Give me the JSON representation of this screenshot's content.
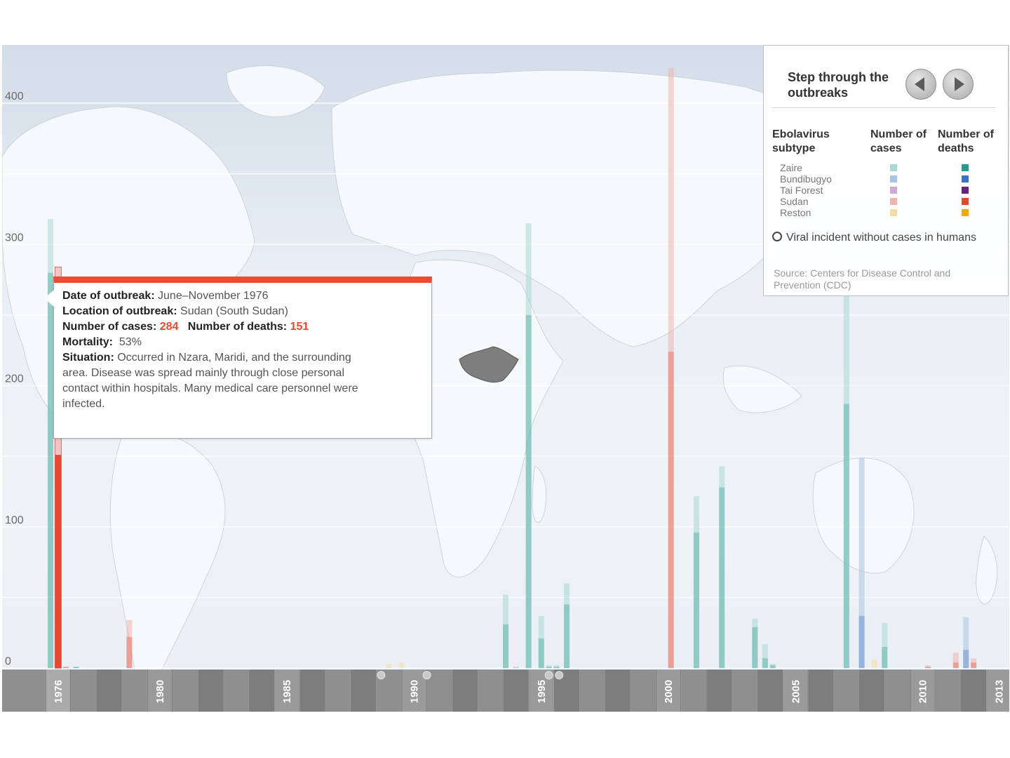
{
  "legend": {
    "step_title": "Step through the outbreaks",
    "col_subtype": "Ebolavirus subtype",
    "col_cases": "Number of cases",
    "col_deaths": "Number of deaths",
    "subtypes": [
      {
        "name": "Zaire",
        "case_color": "#a9d9d4",
        "death_color": "#2a9a8c"
      },
      {
        "name": "Bundibugyo",
        "case_color": "#a9c4e2",
        "death_color": "#3b72c2"
      },
      {
        "name": "Tai Forest",
        "case_color": "#cfa9d3",
        "death_color": "#6a2383"
      },
      {
        "name": "Sudan",
        "case_color": "#f1b3ad",
        "death_color": "#e8482f"
      },
      {
        "name": "Reston",
        "case_color": "#f6dd9f",
        "death_color": "#f1a712"
      }
    ],
    "circle_note": "Viral incident without cases in humans",
    "source": "Source: Centers for Disease Control and Prevention (CDC)"
  },
  "tooltip": {
    "date_label": "Date of outbreak:",
    "date_value": "June–November 1976",
    "location_label": "Location of outbreak:",
    "location_value": "Sudan (South Sudan)",
    "cases_label": "Number of cases:",
    "cases_value": "284",
    "deaths_label": "Number of deaths:",
    "deaths_value": "151",
    "mortality_label": "Mortality:",
    "mortality_value": "53%",
    "situation_label": "Situation:",
    "situation_value": "Occurred in Nzara, Maridi, and the surrounding area. Disease was spread mainly through close personal contact within hospitals. Many medical care personnel were infected."
  },
  "map": {
    "highlighted_region": "South Sudan",
    "highlight_color": "#7f7f7f"
  },
  "chart_data": {
    "type": "bar",
    "title": "",
    "xlabel": "",
    "ylabel": "",
    "ylim": [
      0,
      480
    ],
    "yticks": [
      0,
      100,
      200,
      300,
      400
    ],
    "x_range": [
      1975.4,
      2013.6
    ],
    "year_labels": [
      "1976",
      "1980",
      "1985",
      "1990",
      "1995",
      "2000",
      "2005",
      "2010",
      "2013"
    ],
    "colors": {
      "Zaire": [
        "#a9d9d4",
        "#2a9a8c"
      ],
      "Bundibugyo": [
        "#a9c4e2",
        "#3b72c2"
      ],
      "Tai Forest": [
        "#cfa9d3",
        "#6a2383"
      ],
      "Sudan": [
        "#f1b3ad",
        "#e8482f"
      ],
      "Reston": [
        "#f6dd9f",
        "#f1a712"
      ]
    },
    "outbreaks": [
      {
        "year": 1976.2,
        "subtype": "Zaire",
        "cases": 318,
        "deaths": 280
      },
      {
        "year": 1976.5,
        "subtype": "Sudan",
        "cases": 284,
        "deaths": 151,
        "selected": true
      },
      {
        "year": 1976.8,
        "subtype": "Sudan",
        "cases": 1,
        "deaths": 1
      },
      {
        "year": 1977.2,
        "subtype": "Zaire",
        "cases": 1,
        "deaths": 1
      },
      {
        "year": 1979.3,
        "subtype": "Sudan",
        "cases": 34,
        "deaths": 22
      },
      {
        "year": 1989.5,
        "subtype": "Reston",
        "cases": 3,
        "deaths": 0
      },
      {
        "year": 1990.0,
        "subtype": "Reston",
        "cases": 4,
        "deaths": 0
      },
      {
        "year": 1994.1,
        "subtype": "Zaire",
        "cases": 52,
        "deaths": 31
      },
      {
        "year": 1994.5,
        "subtype": "Tai Forest",
        "cases": 1,
        "deaths": 0
      },
      {
        "year": 1995.0,
        "subtype": "Zaire",
        "cases": 315,
        "deaths": 250
      },
      {
        "year": 1995.5,
        "subtype": "Zaire",
        "cases": 37,
        "deaths": 21
      },
      {
        "year": 1995.8,
        "subtype": "Zaire",
        "cases": 2,
        "deaths": 1
      },
      {
        "year": 1996.1,
        "subtype": "Zaire",
        "cases": 2,
        "deaths": 1
      },
      {
        "year": 1996.5,
        "subtype": "Zaire",
        "cases": 60,
        "deaths": 45
      },
      {
        "year": 2000.6,
        "subtype": "Sudan",
        "cases": 425,
        "deaths": 224
      },
      {
        "year": 2001.6,
        "subtype": "Zaire",
        "cases": 122,
        "deaths": 96
      },
      {
        "year": 2002.6,
        "subtype": "Zaire",
        "cases": 143,
        "deaths": 128
      },
      {
        "year": 2003.9,
        "subtype": "Zaire",
        "cases": 35,
        "deaths": 29
      },
      {
        "year": 2004.3,
        "subtype": "Zaire",
        "cases": 17,
        "deaths": 7
      },
      {
        "year": 2004.6,
        "subtype": "Zaire",
        "cases": 3,
        "deaths": 2
      },
      {
        "year": 2007.5,
        "subtype": "Zaire",
        "cases": 264,
        "deaths": 187
      },
      {
        "year": 2008.1,
        "subtype": "Bundibugyo",
        "cases": 149,
        "deaths": 37
      },
      {
        "year": 2008.6,
        "subtype": "Reston",
        "cases": 6,
        "deaths": 0
      },
      {
        "year": 2009.0,
        "subtype": "Zaire",
        "cases": 32,
        "deaths": 15
      },
      {
        "year": 2010.7,
        "subtype": "Sudan",
        "cases": 2,
        "deaths": 1
      },
      {
        "year": 2011.8,
        "subtype": "Sudan",
        "cases": 11,
        "deaths": 4
      },
      {
        "year": 2012.2,
        "subtype": "Bundibugyo",
        "cases": 36,
        "deaths": 13
      },
      {
        "year": 2012.5,
        "subtype": "Sudan",
        "cases": 7,
        "deaths": 4
      }
    ],
    "no_human_cases": [
      1989.2,
      1991.0,
      1995.8,
      1996.2
    ]
  }
}
